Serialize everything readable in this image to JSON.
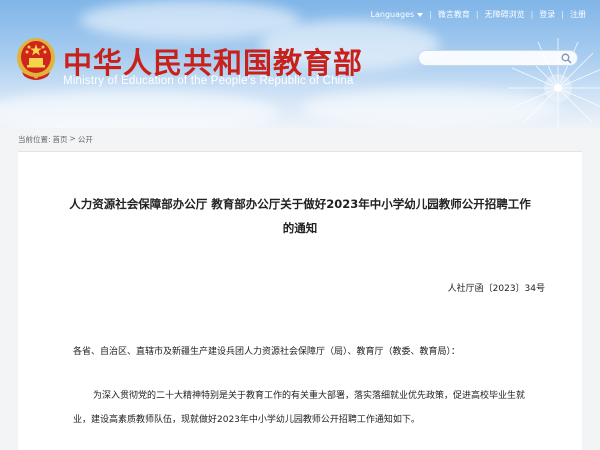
{
  "header": {
    "title_cn": "中华人民共和国教育部",
    "title_en": "Ministry of Education of the People's Republic of China",
    "links": [
      {
        "label": "Languages"
      },
      {
        "label": "微言教育"
      },
      {
        "label": "无障碍浏览"
      },
      {
        "label": "登录"
      },
      {
        "label": "注册"
      }
    ],
    "search_placeholder": ""
  },
  "breadcrumb": {
    "label": "当前位置:",
    "items": [
      "首页",
      "公开"
    ],
    "separator": ">"
  },
  "article": {
    "title_line1": "人力资源社会保障部办公厅 教育部办公厅关于做好2023年中小学幼儿园教师公开招聘工作",
    "title_line2": "的通知",
    "doc_number": "人社厅函〔2023〕34号",
    "recipients": "各省、自治区、直辖市及新疆生产建设兵团人力资源社会保障厅（局）、教育厅（教委、教育局）：",
    "body_line1": "为深入贯彻党的二十大精神特别是关于教育工作的有关重大部署，落实落细就业优先政策，促进高校毕业生就",
    "body_line2": "业，建设高素质教师队伍，现就做好2023年中小学幼儿园教师公开招聘工作通知如下。"
  },
  "colors": {
    "brand_red": "#c8211c",
    "sky_blue": "#7fb5e8"
  }
}
